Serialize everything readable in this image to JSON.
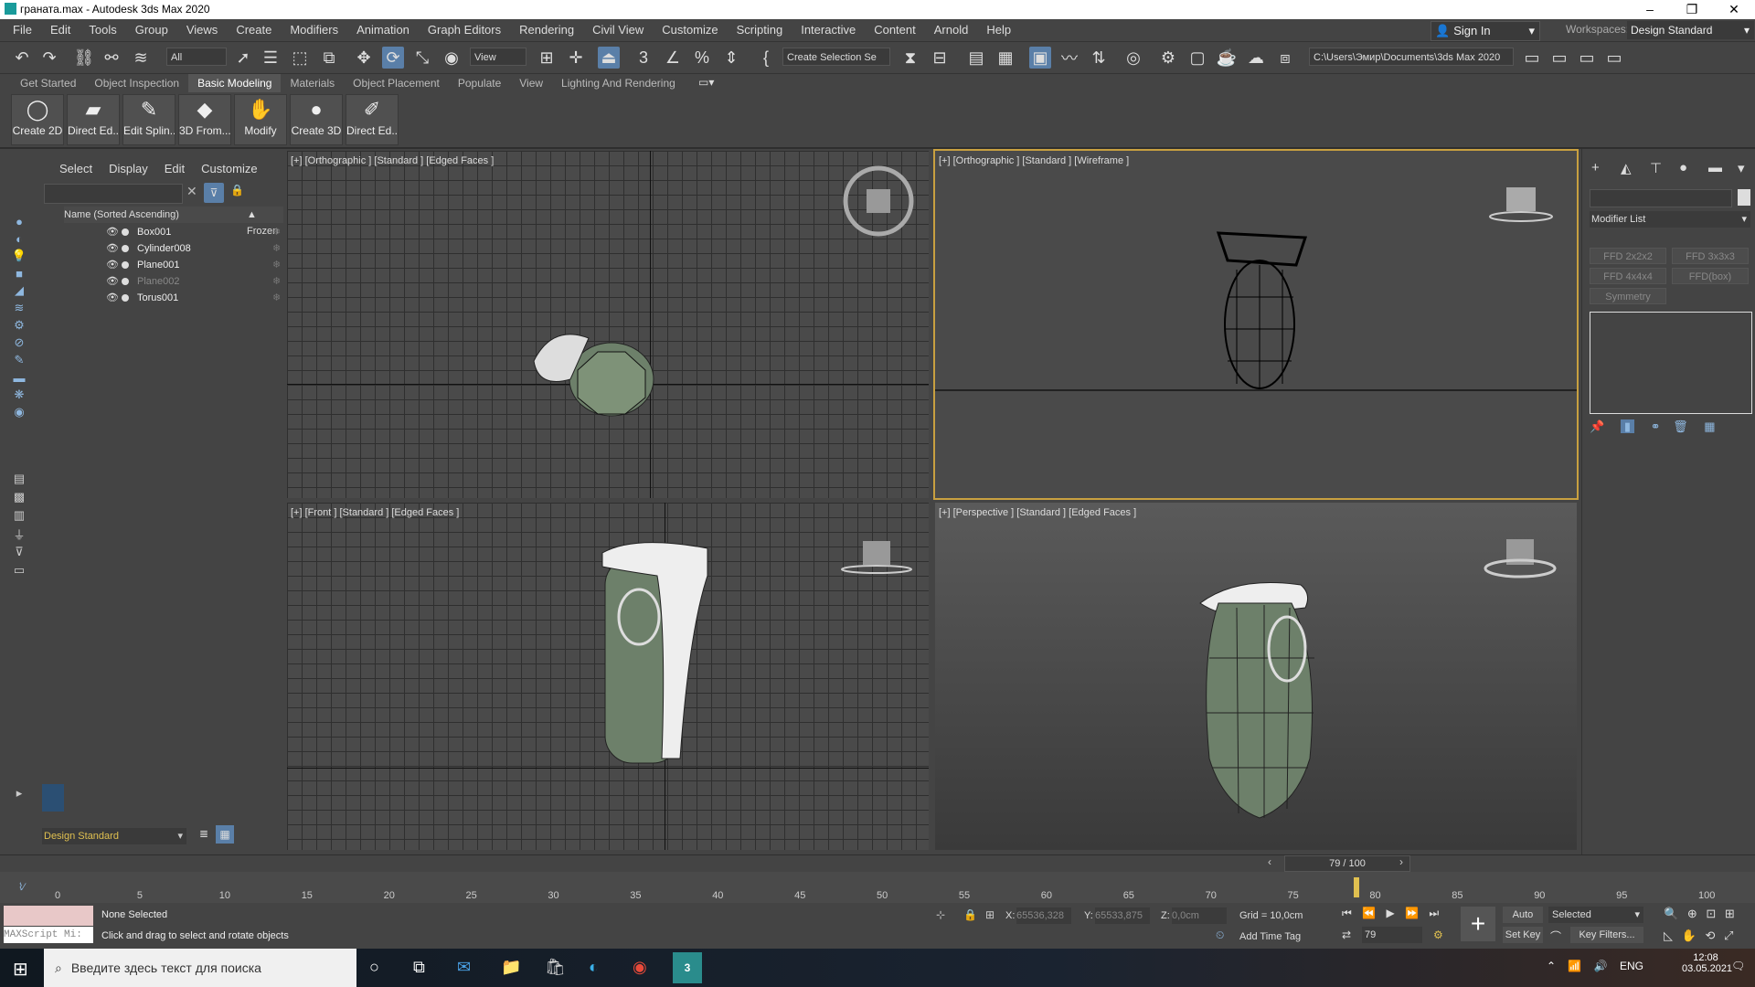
{
  "window": {
    "title": "граната.max - Autodesk 3ds Max 2020",
    "min": "–",
    "max": "❐",
    "close": "✕"
  },
  "menu": [
    "File",
    "Edit",
    "Tools",
    "Group",
    "Views",
    "Create",
    "Modifiers",
    "Animation",
    "Graph Editors",
    "Rendering",
    "Civil View",
    "Customize",
    "Scripting",
    "Interactive",
    "Content",
    "Arnold",
    "Help"
  ],
  "account": {
    "sign_in": "Sign In",
    "workspaces_label": "Workspaces:",
    "workspace": "Design Standard"
  },
  "toolbar": {
    "filter": "All",
    "ref_coord": "View",
    "selection_set": "Create Selection Se",
    "project_path": "C:\\Users\\Эмир\\Documents\\3ds Max 2020"
  },
  "ribbon_tabs": [
    "Get Started",
    "Object Inspection",
    "Basic Modeling",
    "Materials",
    "Object Placement",
    "Populate",
    "View",
    "Lighting And Rendering"
  ],
  "ribbon_buttons": [
    "Create 2D",
    "Direct Ed...",
    "Edit Splin...",
    "3D From...",
    "Modify",
    "Create 3D",
    "Direct Ed..."
  ],
  "scene_explorer": {
    "tabs": [
      "Select",
      "Display",
      "Edit",
      "Customize"
    ],
    "col_name": "Name (Sorted Ascending)",
    "col_frozen": "▲ Frozen",
    "objects": [
      {
        "name": "Box001",
        "dim": false
      },
      {
        "name": "Cylinder008",
        "dim": false
      },
      {
        "name": "Plane001",
        "dim": false
      },
      {
        "name": "Plane002",
        "dim": true
      },
      {
        "name": "Torus001",
        "dim": false
      }
    ],
    "workspace": "Design Standard"
  },
  "viewports": {
    "top_left": "[+] [Orthographic ] [Standard ] [Edged Faces ]",
    "top_right": "[+] [Orthographic ] [Standard ] [Wireframe ]",
    "bottom_left": "[+] [Front ] [Standard ] [Edged Faces ]",
    "bottom_right": "[+] [Perspective ] [Standard ] [Edged Faces ]"
  },
  "command_panel": {
    "modifier_list": "Modifier List",
    "buttons": [
      "FFD 2x2x2",
      "FFD 3x3x3",
      "FFD 4x4x4",
      "FFD(box)",
      "Symmetry"
    ]
  },
  "timeline": {
    "frame": "79 / 100",
    "ticks": [
      "0",
      "5",
      "10",
      "15",
      "20",
      "25",
      "30",
      "35",
      "40",
      "45",
      "50",
      "55",
      "60",
      "65",
      "70",
      "75",
      "80",
      "85",
      "90",
      "95",
      "100"
    ],
    "current_fraction": 0.79
  },
  "status": {
    "selection": "None Selected",
    "prompt": "Click and drag to select and rotate objects",
    "maxscript": "MAXScript Mi:",
    "x_label": "X:",
    "x": "65536,328",
    "y_label": "Y:",
    "y": "65533,875",
    "z_label": "Z:",
    "z": "0,0cm",
    "grid": "Grid = 10,0cm",
    "add_time_tag": "Add Time Tag",
    "auto_key": "Auto Key",
    "set_key": "Set Key",
    "key_mode": "Selected",
    "key_filters": "Key Filters...",
    "frame_field": "79"
  },
  "taskbar": {
    "search": "Введите здесь текст для поиска",
    "lang": "ENG",
    "time": "12:08",
    "date": "03.05.2021"
  }
}
